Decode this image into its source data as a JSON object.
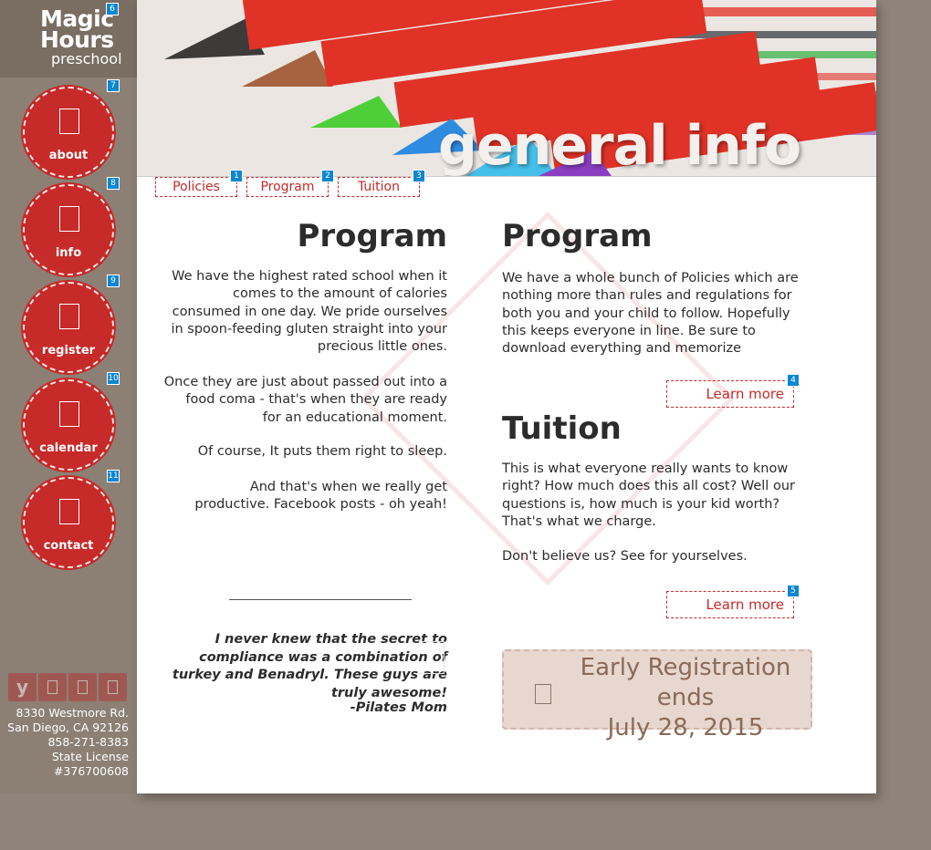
{
  "brand": {
    "line1": "Magic",
    "line2": "Hours",
    "sub": "preschool"
  },
  "badges": [
    "1",
    "2",
    "3",
    "4",
    "5",
    "6",
    "7",
    "8",
    "9",
    "10",
    "11"
  ],
  "nav": [
    {
      "label": "about"
    },
    {
      "label": "info"
    },
    {
      "label": "register"
    },
    {
      "label": "calendar"
    },
    {
      "label": "contact"
    }
  ],
  "social": [
    {
      "glyph": "y"
    }
  ],
  "address": {
    "street": "8330 Westmore Rd.",
    "city": "San Diego, CA 92126",
    "phone": "858-271-8383",
    "license_label": "State License",
    "license_no": "#376700608"
  },
  "banner": {
    "title": "general info"
  },
  "tabs": [
    {
      "label": "Policies"
    },
    {
      "label": "Program"
    },
    {
      "label": "Tuition"
    }
  ],
  "left": {
    "heading": "Program",
    "paragraphs": [
      "We have the highest rated school when it comes to the amount of calories consumed in one day. We pride ourselves in spoon-feeding gluten straight into your precious little ones.",
      "Once they are just about passed out into a food coma - that's when they are ready for an educational moment.",
      "Of course, It puts them right to sleep.",
      "And that's when we really get productive. Facebook posts - oh yeah!"
    ]
  },
  "quote": {
    "text": "I never knew that the secret to compliance was a combination of turkey and Benadryl. These guys are  truly awesome!",
    "author": "-Pilates Mom"
  },
  "right": {
    "program_heading": "Program",
    "program_text": "We have a whole bunch of Policies which are nothing more than rules and regulations for both you and your child to follow. Hopefully this keeps everyone in line. Be sure to download everything and memorize",
    "learn_more_1": "Learn more",
    "tuition_heading": "Tuition",
    "tuition_text": "This is what everyone really wants to know right? How much does this all cost? Well our questions is, how much is your kid worth? That's what we charge.",
    "tuition_text2": "Don't believe us? See for yourselves.",
    "learn_more_2": "Learn more"
  },
  "registration": {
    "line1": "Early Registration",
    "line2": "ends",
    "line3": "July 28, 2015"
  },
  "colors": {
    "accent": "#c62a29",
    "sidebar": "#8c8075",
    "badge": "#0b86d2",
    "reg_bg": "#e7d7cf",
    "reg_text": "#8a6a58"
  }
}
